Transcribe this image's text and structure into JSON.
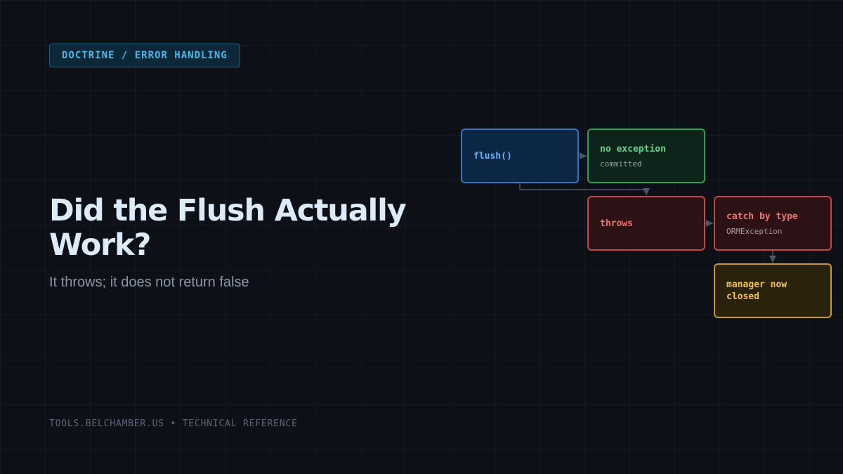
{
  "header": {
    "tag": "DOCTRINE / ERROR HANDLING"
  },
  "hero": {
    "title": "Did the Flush Actually Work?",
    "subtitle": "It throws; it does not return false"
  },
  "footer": {
    "text": "TOOLS.BELCHAMBER.US • TECHNICAL REFERENCE"
  },
  "diagram": {
    "nodes": {
      "flush": {
        "title": "flush()",
        "color": "#2f78c2"
      },
      "no_exception": {
        "title": "no exception",
        "subtitle": "committed",
        "color": "#2da15c"
      },
      "throws": {
        "title": "throws",
        "color": "#c44646"
      },
      "catch": {
        "title": "catch by type",
        "subtitle": "ORMException",
        "color": "#c44646"
      },
      "closed": {
        "title": "manager now closed",
        "color": "#c79a2c"
      }
    },
    "edges": [
      {
        "from": "flush",
        "to": "no_exception"
      },
      {
        "from": "flush",
        "to": "throws"
      },
      {
        "from": "throws",
        "to": "catch"
      },
      {
        "from": "catch",
        "to": "closed"
      }
    ],
    "connector_color": "#4a5568"
  },
  "colors": {
    "background": "#0d1117",
    "accent": "#4cb6e6",
    "title": "#dcebf7"
  }
}
